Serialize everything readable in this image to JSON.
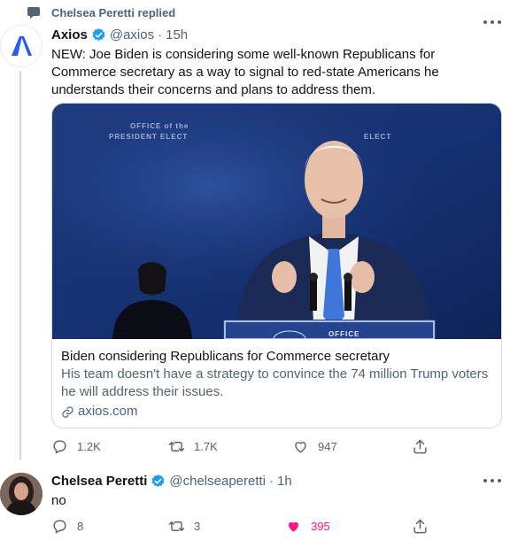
{
  "reply_context": {
    "text": "Chelsea Peretti replied",
    "icon": "speech-bubble-icon"
  },
  "tweet1": {
    "author": {
      "name": "Axios",
      "handle": "@axios",
      "time": "15h",
      "verified": true,
      "logo_letter": "A"
    },
    "text": "NEW: Joe Biden is considering some well-known Republicans for Commerce secretary as a way to signal to red-state Americans he understands their concerns and plans to address them.",
    "card": {
      "sign_left": "OFFICE of the\nPRESIDENT ELECT",
      "sign_right": "ELECT",
      "podium_text": "OFFICE",
      "title": "Biden considering Republicans for Commerce secretary",
      "description": "His team doesn't have a strategy to convince the 74 million Trump voters he will address their issues.",
      "link": "axios.com"
    },
    "actions": {
      "replies": "1.2K",
      "retweets": "1.7K",
      "likes": "947"
    }
  },
  "tweet2": {
    "author": {
      "name": "Chelsea Peretti",
      "handle": "@chelseaperetti",
      "time": "1h",
      "verified": true
    },
    "text": "no",
    "actions": {
      "replies": "8",
      "retweets": "3",
      "likes": "395",
      "liked": true
    }
  },
  "colors": {
    "accent": "#1d9bf0",
    "muted": "#536471",
    "like": "#f91880",
    "axios_blue": "#2a5cf5"
  }
}
